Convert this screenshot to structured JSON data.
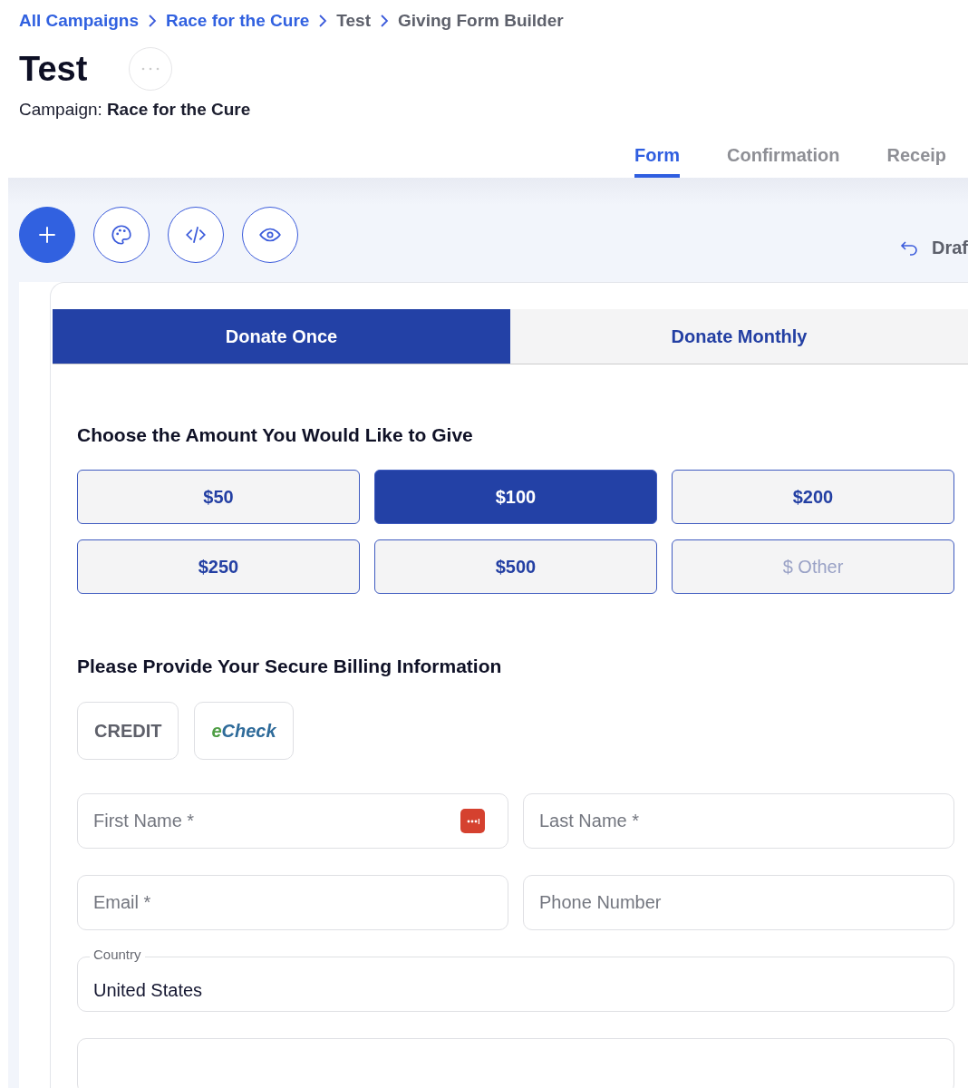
{
  "breadcrumbs": [
    {
      "label": "All Campaigns",
      "link": true
    },
    {
      "label": "Race for the Cure",
      "link": true
    },
    {
      "label": "Test",
      "link": false
    },
    {
      "label": "Giving Form Builder",
      "link": false
    }
  ],
  "title": "Test",
  "campaign": {
    "label": "Campaign:",
    "value": "Race for the Cure"
  },
  "tabs": [
    {
      "label": "Form",
      "selected": true
    },
    {
      "label": "Confirmation",
      "selected": false
    },
    {
      "label": "Receip",
      "selected": false
    }
  ],
  "draft": {
    "label": "Draf"
  },
  "frequency_tabs": [
    {
      "label": "Donate Once",
      "selected": true
    },
    {
      "label": "Donate Monthly",
      "selected": false
    }
  ],
  "amount": {
    "heading": "Choose the Amount You Would Like to Give",
    "options": [
      {
        "kind": "amount",
        "label": "$50",
        "selected": false
      },
      {
        "kind": "amount",
        "label": "$100",
        "selected": true
      },
      {
        "kind": "amount",
        "label": "$200",
        "selected": false
      },
      {
        "kind": "amount",
        "label": "$250",
        "selected": false
      },
      {
        "kind": "amount",
        "label": "$500",
        "selected": false
      },
      {
        "kind": "other",
        "placeholder": "$ Other",
        "selected": false
      }
    ]
  },
  "billing": {
    "heading": "Please Provide Your Secure Billing Information",
    "methods": [
      "CREDIT",
      "eCheck"
    ],
    "fields": [
      {
        "kind": "input",
        "placeholder": "First Name *",
        "autofill": true
      },
      {
        "kind": "input",
        "placeholder": "Last Name *"
      },
      {
        "kind": "input",
        "placeholder": "Email *"
      },
      {
        "kind": "input",
        "placeholder": "Phone Number"
      },
      {
        "kind": "select",
        "label": "Country",
        "value": "United States"
      },
      {
        "kind": "input"
      }
    ]
  }
}
